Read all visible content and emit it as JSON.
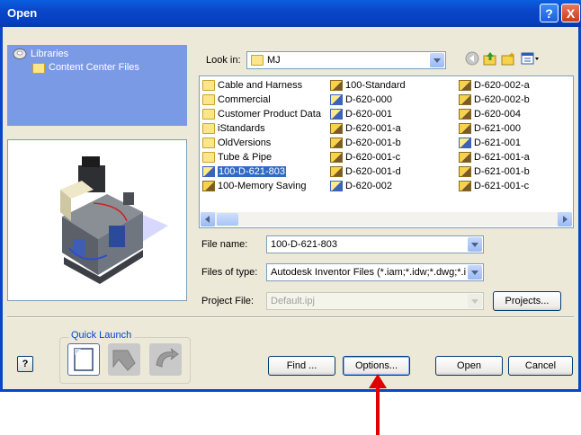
{
  "window": {
    "title": "Open",
    "help_glyph": "?",
    "close_glyph": "X"
  },
  "libraries": {
    "title": "Libraries",
    "items": [
      "Content Center Files"
    ]
  },
  "look_in": {
    "label": "Look in:",
    "value": "MJ"
  },
  "toolbar_icons": [
    "back-icon",
    "up-folder-icon",
    "new-folder-icon",
    "views-menu-icon"
  ],
  "files": {
    "col1": [
      {
        "name": "Cable and Harness",
        "type": "folder"
      },
      {
        "name": "Commercial",
        "type": "folder"
      },
      {
        "name": "Customer Product Data",
        "type": "folder"
      },
      {
        "name": "iStandards",
        "type": "folder"
      },
      {
        "name": "OldVersions",
        "type": "folder"
      },
      {
        "name": "Tube & Pipe",
        "type": "folder"
      },
      {
        "name": "100-D-621-803",
        "type": "drawing",
        "selected": true
      },
      {
        "name": "100-Memory Saving",
        "type": "assembly"
      }
    ],
    "col2": [
      {
        "name": "100-Standard",
        "type": "assembly"
      },
      {
        "name": "D-620-000",
        "type": "drawing"
      },
      {
        "name": "D-620-001",
        "type": "drawing"
      },
      {
        "name": "D-620-001-a",
        "type": "assembly"
      },
      {
        "name": "D-620-001-b",
        "type": "assembly"
      },
      {
        "name": "D-620-001-c",
        "type": "assembly"
      },
      {
        "name": "D-620-001-d",
        "type": "assembly"
      },
      {
        "name": "D-620-002",
        "type": "drawing"
      }
    ],
    "col3": [
      {
        "name": "D-620-002-a",
        "type": "assembly"
      },
      {
        "name": "D-620-002-b",
        "type": "assembly"
      },
      {
        "name": "D-620-004",
        "type": "assembly"
      },
      {
        "name": "D-621-000",
        "type": "assembly"
      },
      {
        "name": "D-621-001",
        "type": "drawing"
      },
      {
        "name": "D-621-001-a",
        "type": "assembly"
      },
      {
        "name": "D-621-001-b",
        "type": "assembly"
      },
      {
        "name": "D-621-001-c",
        "type": "assembly"
      }
    ]
  },
  "file_name": {
    "label": "File name:",
    "value": "100-D-621-803"
  },
  "files_of_type": {
    "label": "Files of type:",
    "value": "Autodesk Inventor Files (*.iam;*.idw;*.dwg;*.i"
  },
  "project_file": {
    "label": "Project File:",
    "value": "Default.ipj"
  },
  "buttons": {
    "projects": "Projects...",
    "find": "Find ...",
    "options": "Options...",
    "open": "Open",
    "cancel": "Cancel",
    "help": "?"
  },
  "quick_launch": {
    "label": "Quick Launch",
    "items": [
      "new-file-icon",
      "open-arrow-icon",
      "refresh-arrow-icon"
    ]
  },
  "colors": {
    "titlebar": "#0a46c8",
    "dialog": "#ece9d8",
    "selection": "#316ac5",
    "annotation_arrow": "#e00000"
  }
}
